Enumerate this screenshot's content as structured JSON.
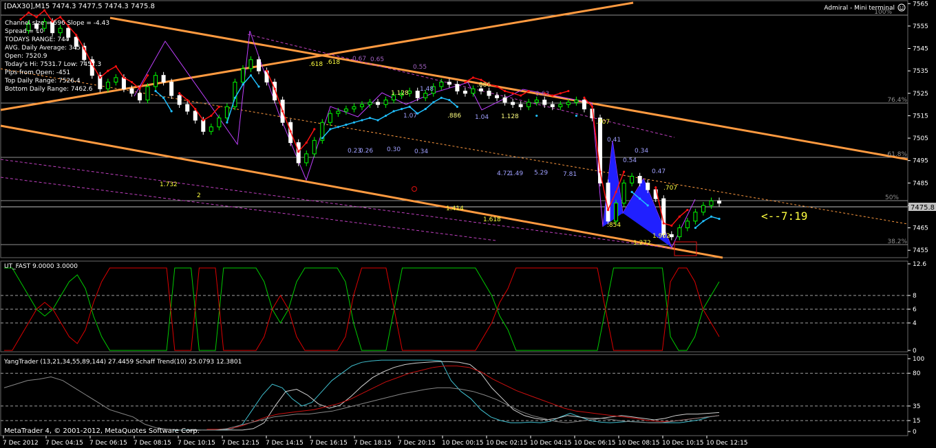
{
  "header": {
    "symbol_line": "[DAX30],M15  7474.3 7477.5 7474.3 7475.8",
    "terminal_label": "Admiral - Mini terminal"
  },
  "info_lines": [
    "Channel size = 596 Slope = -4.43",
    "Spread = 10",
    "TODAYS RANGE: 744",
    "AVG. Daily Average: 345",
    "Open: 7520.9",
    "Today's Hi: 7531.7  Low: 7457.3",
    "Pips from Open: -451",
    "Top Daily Range: 7526.4",
    "Bottom Daily Range: 7462.6"
  ],
  "fib_labels": [
    "100%",
    "76.4%",
    "61.8%",
    "50%",
    "38.2%"
  ],
  "countdown": "<--7:19",
  "current_price_tag": "7475.8",
  "indicator1_title": "UT_FAST 9.0000 3.0000",
  "indicator2_title": "YangTrader (13,21,34,55,89,144) 27.4459  Schaff Trend(10) 25.0793 12.3801",
  "copyright": "MetaTrader 4, © 2001-2012, MetaQuotes Software Corp.",
  "pattern_labels": [
    {
      "t": "1.128"
    },
    {
      "t": "1.48"
    },
    {
      "t": ".886"
    },
    {
      "t": "1.07"
    },
    {
      "t": ".886"
    },
    {
      "t": "1.04"
    },
    {
      "t": "1.128"
    },
    {
      "t": "0.23"
    },
    {
      "t": "0.26"
    },
    {
      "t": "0.30"
    },
    {
      "t": "0.34"
    },
    {
      "t": "4.72"
    },
    {
      "t": "1.49"
    },
    {
      "t": "5.29"
    },
    {
      "t": "7.81"
    },
    {
      "t": "0.41"
    },
    {
      "t": "0.34"
    },
    {
      "t": "0.54"
    },
    {
      "t": "0.47"
    },
    {
      "t": "0.67"
    },
    {
      "t": "0.65"
    },
    {
      "t": "0.55"
    },
    {
      "t": "0.63"
    },
    {
      "t": ".618"
    },
    {
      "t": ".618"
    },
    {
      "t": ".707"
    },
    {
      "t": ".707"
    },
    {
      "t": ".854"
    },
    {
      "t": "1.902"
    },
    {
      "t": "1.272"
    },
    {
      "t": "1.414"
    },
    {
      "t": "1.618"
    },
    {
      "t": "1.732"
    },
    {
      "t": "2"
    }
  ],
  "chart_data": {
    "type": "line",
    "title": "[DAX30],M15",
    "price_axis": {
      "ticks": [
        7565,
        7555,
        7545,
        7535,
        7525,
        7515,
        7505,
        7495,
        7485,
        7475,
        7465,
        7455
      ],
      "ylim": [
        7452,
        7566
      ]
    },
    "ohlc_current": {
      "open": 7474.3,
      "high": 7477.5,
      "low": 7474.3,
      "close": 7475.8
    },
    "x_tick_labels": [
      "7 Dec 2012",
      "7 Dec 04:15",
      "7 Dec 06:15",
      "7 Dec 08:15",
      "7 Dec 10:15",
      "7 Dec 12:15",
      "7 Dec 14:15",
      "7 Dec 16:15",
      "7 Dec 18:15",
      "7 Dec 20:15",
      "10 Dec 00:15",
      "10 Dec 02:15",
      "10 Dec 04:15",
      "10 Dec 06:15",
      "10 Dec 08:15",
      "10 Dec 10:15",
      "10 Dec 12:15"
    ],
    "close_series": [
      7553,
      7556,
      7554,
      7557,
      7552,
      7554,
      7550,
      7546,
      7540,
      7533,
      7527,
      7530,
      7532,
      7527,
      7525,
      7522,
      7528,
      7533,
      7530,
      7524,
      7520,
      7517,
      7513,
      7508,
      7510,
      7514,
      7519,
      7530,
      7536,
      7540,
      7535,
      7530,
      7522,
      7512,
      7503,
      7494,
      7498,
      7504,
      7512,
      7516,
      7517,
      7518,
      7519,
      7520,
      7521,
      7520,
      7522,
      7524,
      7525,
      7526,
      7523,
      7525,
      7528,
      7530,
      7529,
      7526,
      7525,
      7527,
      7526,
      7524,
      7523,
      7521,
      7520,
      7519,
      7521,
      7522,
      7520,
      7519,
      7520,
      7521,
      7522,
      7518,
      7514,
      7485,
      7468,
      7476,
      7485,
      7488,
      7485,
      7482,
      7478,
      7462,
      7461,
      7465,
      7468,
      7472,
      7475,
      7477,
      7476
    ],
    "ut_fast": {
      "ylim": [
        0,
        12.6
      ],
      "ticks": [
        12.6,
        8,
        6,
        4,
        0.0
      ],
      "levels": [
        8,
        6,
        4
      ],
      "series": [
        {
          "name": "green",
          "color": "#00cc00",
          "values": [
            12,
            12,
            10,
            8,
            6,
            5,
            6,
            8,
            10,
            11,
            9,
            5,
            2,
            0,
            0,
            0,
            0,
            0,
            0,
            0,
            0,
            12,
            12,
            12,
            0,
            0,
            0,
            12,
            12,
            12,
            12,
            12,
            10,
            6,
            4,
            6,
            10,
            12,
            12,
            12,
            12,
            12,
            10,
            4,
            0,
            0,
            0,
            0,
            6,
            12,
            12,
            12,
            12,
            12,
            12,
            12,
            12,
            12,
            12,
            10,
            8,
            5,
            3,
            0,
            0,
            0,
            0,
            0,
            0,
            0,
            0,
            0,
            0,
            0,
            6,
            12,
            12,
            12,
            12,
            12,
            12,
            12,
            2,
            0,
            0,
            2,
            6,
            8,
            10
          ]
        },
        {
          "name": "red",
          "color": "#dd0000",
          "values": [
            0,
            0,
            2,
            4,
            6,
            7,
            6,
            4,
            2,
            1,
            3,
            7,
            10,
            12,
            12,
            12,
            12,
            12,
            12,
            12,
            12,
            0,
            0,
            0,
            12,
            12,
            12,
            0,
            0,
            0,
            0,
            0,
            2,
            6,
            8,
            6,
            2,
            0,
            0,
            0,
            0,
            0,
            2,
            8,
            12,
            12,
            12,
            12,
            6,
            0,
            0,
            0,
            0,
            0,
            0,
            0,
            0,
            0,
            0,
            2,
            4,
            7,
            9,
            12,
            12,
            12,
            12,
            12,
            12,
            12,
            12,
            12,
            12,
            12,
            6,
            0,
            0,
            0,
            0,
            0,
            0,
            0,
            10,
            12,
            12,
            10,
            6,
            4,
            2
          ]
        }
      ]
    },
    "yang_trader": {
      "ylim": [
        0,
        100
      ],
      "ticks": [
        100,
        80,
        35,
        15,
        0
      ],
      "levels": [
        80,
        35,
        15
      ],
      "series": [
        {
          "name": "schaff",
          "color": "#40c0d0",
          "values": [
            null,
            null,
            null,
            null,
            null,
            null,
            null,
            null,
            null,
            null,
            null,
            null,
            null,
            null,
            null,
            null,
            null,
            2,
            2,
            2,
            2,
            2,
            2,
            4,
            10,
            30,
            50,
            65,
            60,
            45,
            35,
            40,
            55,
            70,
            80,
            90,
            95,
            97,
            98,
            98,
            98,
            98,
            98,
            98,
            97,
            70,
            55,
            45,
            30,
            20,
            15,
            12,
            12,
            13,
            12,
            14,
            20,
            25,
            20,
            15,
            13,
            12,
            13,
            14,
            13,
            12,
            12,
            12,
            12,
            14,
            16,
            20,
            22
          ]
        },
        {
          "name": "signal",
          "color": "#d0d0d0",
          "values": [
            null,
            null,
            null,
            null,
            null,
            null,
            null,
            null,
            null,
            null,
            null,
            null,
            null,
            null,
            null,
            null,
            null,
            2,
            2,
            2,
            2,
            2,
            2,
            4,
            12,
            35,
            55,
            58,
            50,
            38,
            32,
            36,
            48,
            62,
            74,
            82,
            88,
            92,
            94,
            95,
            96,
            96,
            95,
            92,
            80,
            60,
            45,
            30,
            22,
            18,
            16,
            18,
            22,
            20,
            18,
            18,
            20,
            22,
            20,
            18,
            16,
            18,
            22,
            24,
            24,
            25,
            26
          ]
        },
        {
          "name": "yang",
          "color": "#cc1010",
          "values": [
            null,
            null,
            null,
            null,
            null,
            null,
            null,
            null,
            null,
            null,
            null,
            null,
            null,
            null,
            null,
            null,
            null,
            3,
            3,
            4,
            8,
            14,
            20,
            24,
            26,
            28,
            30,
            34,
            38,
            44,
            52,
            60,
            68,
            74,
            80,
            84,
            88,
            90,
            90,
            88,
            82,
            72,
            64,
            56,
            50,
            44,
            38,
            32,
            28,
            26,
            24,
            22,
            20,
            18,
            15,
            14,
            14,
            16,
            18,
            20,
            22
          ]
        },
        {
          "name": "gray",
          "color": "#888888",
          "values": [
            60,
            65,
            70,
            72,
            75,
            70,
            60,
            50,
            40,
            30,
            25,
            20,
            10,
            5,
            3,
            2,
            1,
            2,
            2,
            4,
            8,
            12,
            16,
            20,
            22,
            24,
            24,
            26,
            28,
            32,
            36,
            40,
            44,
            48,
            52,
            55,
            58,
            60,
            60,
            58,
            55,
            50,
            44,
            36,
            28,
            22,
            18,
            14,
            12,
            14,
            16,
            18,
            16,
            14,
            13,
            12,
            12,
            14,
            16,
            18,
            20,
            22
          ]
        }
      ]
    }
  }
}
